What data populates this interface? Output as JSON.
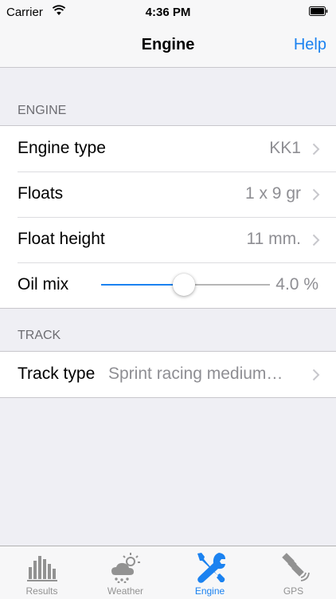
{
  "status_bar": {
    "carrier": "Carrier",
    "time": "4:36 PM"
  },
  "nav": {
    "title": "Engine",
    "help": "Help"
  },
  "sections": {
    "engine": {
      "header": "ENGINE",
      "engine_type": {
        "label": "Engine type",
        "value": "KK1"
      },
      "floats": {
        "label": "Floats",
        "value": "1 x 9 gr"
      },
      "float_height": {
        "label": "Float height",
        "value": "11 mm."
      },
      "oil_mix": {
        "label": "Oil mix",
        "value": "4.0 %",
        "slider_fraction": 0.49
      }
    },
    "track": {
      "header": "TRACK",
      "track_type": {
        "label": "Track type",
        "value": "Sprint racing medium…"
      }
    }
  },
  "tabs": [
    {
      "label": "Results",
      "icon": "bar-chart-icon"
    },
    {
      "label": "Weather",
      "icon": "weather-icon"
    },
    {
      "label": "Engine",
      "icon": "wrench-screwdriver-icon",
      "active": true
    },
    {
      "label": "GPS",
      "icon": "satellite-icon"
    }
  ],
  "colors": {
    "accent": "#1b82f0",
    "inactive": "#929292",
    "background": "#efeff4"
  }
}
